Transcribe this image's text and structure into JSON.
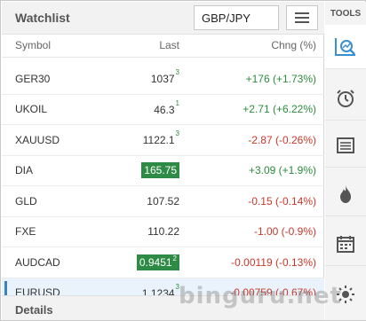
{
  "watchlist": {
    "title": "Watchlist",
    "symbol_value": "GBP/JPY",
    "columns": {
      "symbol": "Symbol",
      "last": "Last",
      "chng": "Chng (%)"
    },
    "rows": [
      {
        "symbol": "GER30",
        "last_main": "1037",
        "last_sup": "3",
        "highlight": "",
        "change": "+176 (+1.73%)",
        "dir": "pos"
      },
      {
        "symbol": "UKOIL",
        "last_main": "46.3",
        "last_sup": "1",
        "highlight": "",
        "change": "+2.71 (+6.22%)",
        "dir": "pos"
      },
      {
        "symbol": "XAUUSD",
        "last_main": "1122.1",
        "last_sup": "3",
        "highlight": "",
        "change": "-2.87 (-0.26%)",
        "dir": "neg"
      },
      {
        "symbol": "DIA",
        "last_main": "165.75",
        "last_sup": "",
        "highlight": "#2e8b46",
        "change": "+3.09 (+1.9%)",
        "dir": "pos"
      },
      {
        "symbol": "GLD",
        "last_main": "107.52",
        "last_sup": "",
        "highlight": "",
        "change": "-0.15 (-0.14%)",
        "dir": "neg"
      },
      {
        "symbol": "FXE",
        "last_main": "110.22",
        "last_sup": "",
        "highlight": "",
        "change": "-1.00 (-0.9%)",
        "dir": "neg"
      },
      {
        "symbol": "AUDCAD",
        "last_main": "0.9451",
        "last_sup": "2",
        "highlight": "#2e8b46",
        "change": "-0.00119 (-0.13%)",
        "dir": "neg"
      },
      {
        "symbol": "EURUSD",
        "last_main": "1.1234",
        "last_sup": "3",
        "highlight": "",
        "change": "-0.00759 (-0.67%)",
        "dir": "neg",
        "selected": true
      }
    ]
  },
  "details": {
    "label": "Details"
  },
  "tools": {
    "label": "TOOLS",
    "items": [
      {
        "icon": "chart-search-icon",
        "active": true
      },
      {
        "icon": "alarm-clock-icon",
        "active": false
      },
      {
        "icon": "news-list-icon",
        "active": false
      },
      {
        "icon": "flame-icon",
        "active": false
      },
      {
        "icon": "calendar-icon",
        "active": false
      },
      {
        "icon": "sun-icon",
        "active": false
      }
    ]
  },
  "watermark": "binguru.net",
  "colors": {
    "positive": "#2c8c3c",
    "negative": "#c8382a",
    "accent": "#3a82c4",
    "highlight": "#2e8b46"
  }
}
